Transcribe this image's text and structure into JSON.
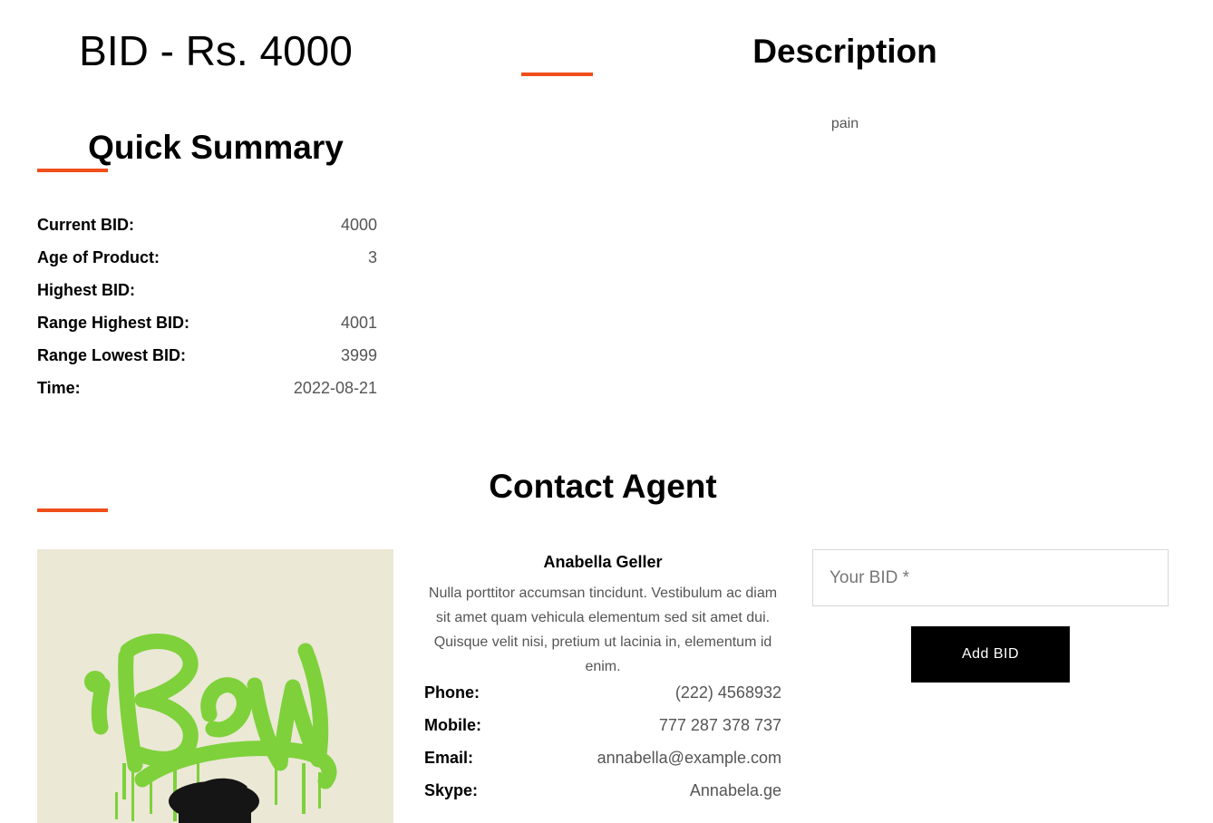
{
  "header": {
    "bid_title": "BID - Rs. 4000"
  },
  "description": {
    "title": "Description",
    "text": "pain"
  },
  "quick_summary": {
    "title": "Quick Summary",
    "rows": [
      {
        "label": "Current BID:",
        "value": "4000"
      },
      {
        "label": "Age of Product:",
        "value": "3"
      },
      {
        "label": "Highest BID:",
        "value": ""
      },
      {
        "label": "Range Highest BID:",
        "value": "4001"
      },
      {
        "label": "Range Lowest BID:",
        "value": "3999"
      },
      {
        "label": "Time:",
        "value": "2022-08-21"
      }
    ]
  },
  "contact_agent": {
    "title": "Contact Agent",
    "name": "Anabella Geller",
    "bio": "Nulla porttitor accumsan tincidunt. Vestibulum ac diam sit amet quam vehicula elementum sed sit amet dui. Quisque velit nisi, pretium ut lacinia in, elementum id enim.",
    "details": [
      {
        "label": "Phone:",
        "value": "(222) 4568932"
      },
      {
        "label": "Mobile:",
        "value": "777 287 378 737"
      },
      {
        "label": "Email:",
        "value": "annabella@example.com"
      },
      {
        "label": "Skype:",
        "value": "Annabela.ge"
      }
    ],
    "photo_logo_text": "iBow"
  },
  "bid_form": {
    "placeholder": "Your BID *",
    "value": "",
    "button_label": "Add BID"
  },
  "colors": {
    "accent": "#f04e1b",
    "button_bg": "#000000",
    "graffiti_green": "#7ed13a"
  }
}
